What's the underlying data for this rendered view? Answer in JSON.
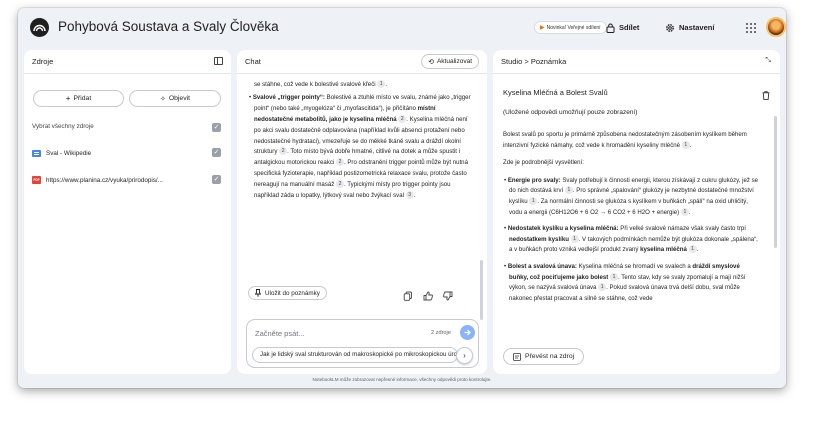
{
  "app": {
    "title": "Pohybová Soustava a Svaly Člověka",
    "badge": "Novinka! Veřejné sdílení",
    "share_label": "Sdílet",
    "settings_label": "Nastavení"
  },
  "sources": {
    "heading": "Zdroje",
    "add_label": "Přidat",
    "discover_label": "Objevit",
    "select_all_label": "Vybrat všechny zdroje",
    "items": [
      {
        "icon": "doc-icon",
        "label": "Sval - Wikipedie"
      },
      {
        "icon": "pdf-icon",
        "label": "https://www.planina.cz/vyuka/prirodopis/..."
      }
    ]
  },
  "chat": {
    "heading": "Chat",
    "refresh_label": "Aktualizovat",
    "top_line": "se stáhne, což vede k bolestivé svalové křeči",
    "top_cite": "1",
    "bullet_title": "Svalové „trigger pointy“:",
    "s1": " Bolestivé a ztuhlé místo ve svalu, známé jako „trigger point“ (nebo také „myogelóza“ či „myofascitida“), je přičítáno ",
    "s1_bold": "místní nedostatečné metabolitů, jako je kyselina mléčná",
    "s1_cite": "2",
    "s2": ". Kyselina mléčná není po akci svalu dostatečně odplavována (například kvůli absenci protažení nebo nedostatečné hydrataci), vmezeřuje se do měkké tkáně svalu a dráždí okolní struktury",
    "s2_cite": "2",
    "s3": ". Toto místo bývá dobře hmatné, citlivé na dotek a může spustit i antalgickou motorickou reakci",
    "s3_cite": "2",
    "s4": ". Pro odstranění trigger pointů může být nutná specifická fyzioterapie, například postizometrická relaxace svalu, protože často nereagují na manuální masáž",
    "s4_cite": "2",
    "s5": ". Typickými místy pro trigger pointy jsou například záda u lopatky, lýtkový sval nebo žvýkací sval",
    "s5_cite": "3",
    "save_note_label": "Uložit do poznámky",
    "input_placeholder": "Začněte psát...",
    "source_count": "2 zdroje",
    "suggestion": "Jak je lidský sval strukturován od makroskopické po mikroskopickou úroveň?"
  },
  "studio": {
    "breadcrumb": "Studio > Poznámka",
    "note_title": "Kyselina Mléčná a Bolest Svalů",
    "note_subtitle": "(Uložené odpovědi umožňují pouze zobrazení)",
    "intro": "Bolest svalů po sportu je primárně způsobena nedostatečným zásobením kyslíkem během intenzivní fyzické námahy, což vede k hromadění kyseliny mléčné",
    "intro_cite": "1",
    "detail_label": "Zde je podrobnější vysvětlení:",
    "b1_title": "Energie pro svaly:",
    "b1_text": " Svaly potřebují k činnosti energii, kterou získávají z cukru glukózy, jež se do nich dostává krví",
    "b1_c1": "1",
    "b1_text2": ". Pro správné „spalování“ glukózy je nezbytné dostatečné množství kyslíku",
    "b1_c2": "1",
    "b1_text3": ". Za normální činnosti se glukóza s kyslíkem v buňkách „spálí“ na oxid uhličitý, vodu a energii (C6H12O6 + 6 O2 → 6 CO2 + 6 H2O + energie)",
    "b1_c3": "1",
    "b2_title": "Nedostatek kyslíku a kyselina mléčná:",
    "b2_text": " Při velké svalové námaze však svaly často trpí ",
    "b2_bold": "nedostatkem kyslíku",
    "b2_c1": "1",
    "b2_text2": ". V takových podmínkách nemůže být glukóza dokonale „spálena“, a v buňkách proto vzniká vedlejší produkt zvaný ",
    "b2_bold2": "kyselina mléčná",
    "b2_c2": "1",
    "b3_title": "Bolest a svalová únava:",
    "b3_text": " Kyselina mléčná se hromadí ve svalech a ",
    "b3_bold": "dráždí smyslové buňky, což pociťujeme jako bolest",
    "b3_c1": "1",
    "b3_text2": ". Tento stav, kdy se svaly zpomalují a mají nižší výkon, se nazývá svalová únava",
    "b3_c2": "1",
    "b3_text3": ". Pokud svalová únava trvá delší dobu, sval může nakonec přestat pracovat a silně se stáhne, což vede",
    "convert_label": "Převést na zdroj"
  },
  "footer": "NotebookLM může zobrazovat nepřesné informace, všechny odpovědi proto kontrolujte."
}
